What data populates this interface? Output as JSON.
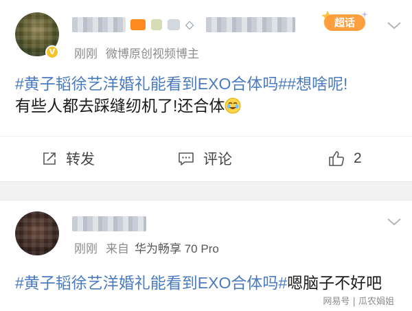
{
  "post1": {
    "meta_time": "刚刚",
    "meta_role": "微博原创视频博主",
    "badge_label": "超话",
    "text_topic": "#黄子韬徐艺洋婚礼能看到EXO合体吗#",
    "text_topic2": "#想啥呢!",
    "text_body": "有些人都去踩缝纫机了!还合体",
    "emoji": "crying-laughing-emoji",
    "actions": {
      "repost_label": "转发",
      "comment_label": "评论",
      "like_count": "2"
    }
  },
  "post2": {
    "meta_time": "刚刚",
    "meta_from": "来自",
    "meta_device": "华为畅享 70 Pro",
    "text_topic": "#黄子韬徐艺洋婚礼能看到EXO合体吗#",
    "text_body": "嗯脑子不好吧"
  },
  "watermark": "网易号 | 瓜农娟姐",
  "colors": {
    "topic": "#4a7bbf",
    "badge": "#ff9e3c",
    "vip": "#f6c32b"
  }
}
